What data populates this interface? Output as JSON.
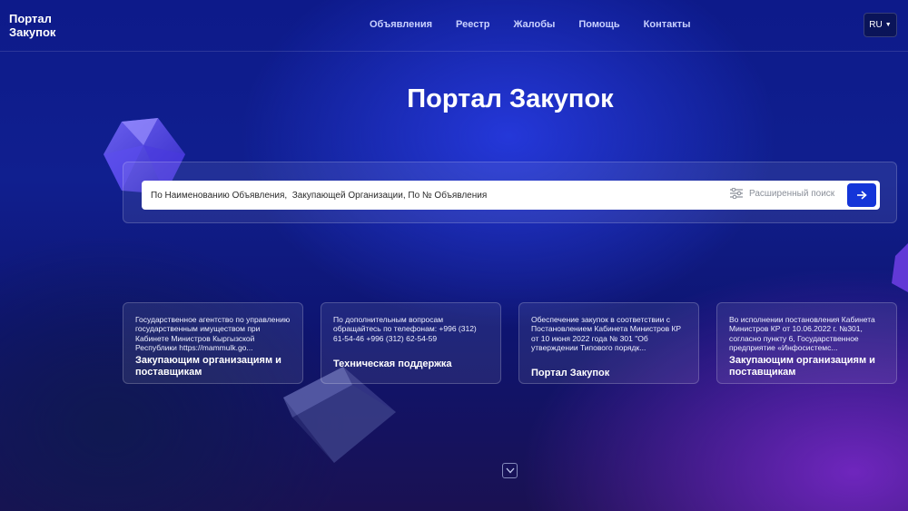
{
  "header": {
    "logo_line1": "Портал",
    "logo_line2": "Закупок",
    "nav": [
      "Объявления",
      "Реестр",
      "Жалобы",
      "Помощь",
      "Контакты"
    ],
    "language": "RU"
  },
  "hero": {
    "title": "Портал Закупок"
  },
  "search": {
    "placeholder": "По Наименованию Объявления,  Закупающей Организации, По № Объявления",
    "advanced_label": "Расширенный поиск",
    "advanced_icon": "sliders-icon",
    "submit_icon": "arrow-right-icon",
    "accent_color": "#1435d8"
  },
  "cards": [
    {
      "text": "Государственное агентство по управлению государственным имуществом при Кабинете Министров Кыргызской Республики https://mammulk.go...",
      "title": "Закупающим организациям и поставщикам"
    },
    {
      "text": "По дополнительным вопросам обращайтесь по телефонам: +996 (312) 61-54-46 +996 (312) 62-54-59",
      "title": "Техническая поддержка"
    },
    {
      "text": "Обеспечение закупок в соответствии с Постановлением Кабинета Министров КР от 10 июня 2022 года № 301 \"Об утверждении Типового порядк...",
      "title": "Портал Закупок"
    },
    {
      "text": "Во исполнении постановления Кабинета Министров КР от 10.06.2022 г. №301, согласно пункту 6, Государственное предприятие «Инфосистемс...",
      "title": "Закупающим организациям и поставщикам"
    }
  ],
  "scroll_icon": "chevron-down-icon"
}
